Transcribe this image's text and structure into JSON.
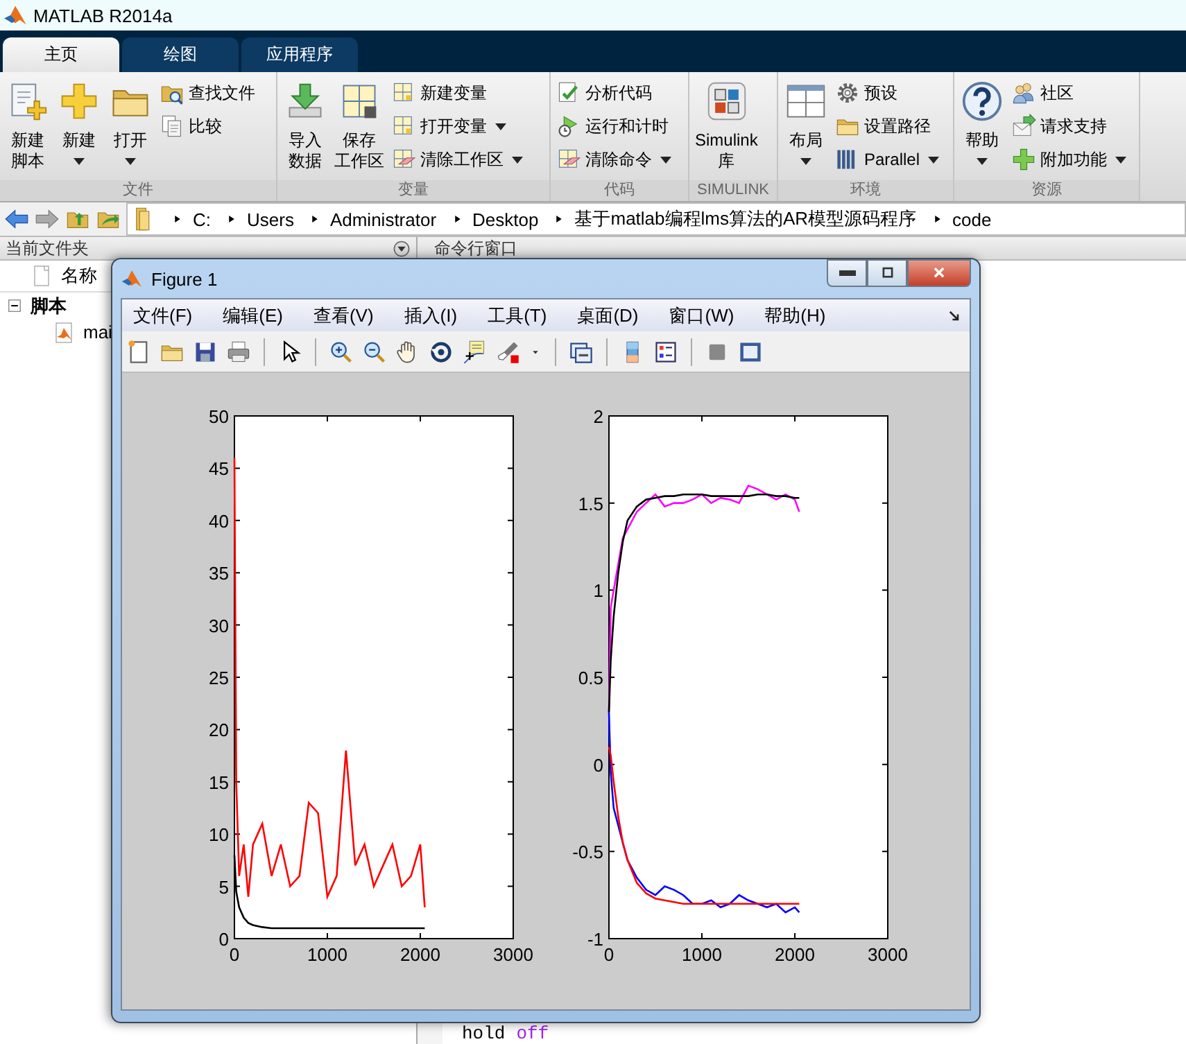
{
  "app": {
    "title": "MATLAB R2014a"
  },
  "tabs": [
    {
      "label": "主页",
      "selected": true
    },
    {
      "label": "绘图",
      "selected": false
    },
    {
      "label": "应用程序",
      "selected": false
    }
  ],
  "ribbon": [
    {
      "label": "文件",
      "items": [
        {
          "kind": "large",
          "lines": [
            "新建",
            "脚本"
          ],
          "dropdown": false
        },
        {
          "kind": "large",
          "lines": [
            "新建"
          ],
          "dropdown": true
        },
        {
          "kind": "large",
          "lines": [
            "打开"
          ],
          "dropdown": true
        },
        {
          "kind": "stack",
          "items": [
            {
              "label": "查找文件",
              "dropdown": false
            },
            {
              "label": "比较",
              "dropdown": false
            }
          ]
        }
      ]
    },
    {
      "label": "变量",
      "items": [
        {
          "kind": "large",
          "lines": [
            "导入",
            "数据"
          ],
          "dropdown": false
        },
        {
          "kind": "large",
          "lines": [
            "保存",
            "工作区"
          ],
          "dropdown": false
        },
        {
          "kind": "stack",
          "items": [
            {
              "label": "新建变量",
              "dropdown": false
            },
            {
              "label": "打开变量",
              "dropdown": true
            },
            {
              "label": "清除工作区",
              "dropdown": true
            }
          ]
        }
      ]
    },
    {
      "label": "代码",
      "items": [
        {
          "kind": "stack",
          "items": [
            {
              "label": "分析代码",
              "dropdown": false
            },
            {
              "label": "运行和计时",
              "dropdown": false
            },
            {
              "label": "清除命令",
              "dropdown": true
            }
          ]
        }
      ]
    },
    {
      "label": "SIMULINK",
      "items": [
        {
          "kind": "large",
          "lines": [
            "Simulink",
            "库"
          ],
          "dropdown": false
        }
      ]
    },
    {
      "label": "环境",
      "items": [
        {
          "kind": "large",
          "lines": [
            "布局"
          ],
          "dropdown": true
        },
        {
          "kind": "stack",
          "items": [
            {
              "label": "预设",
              "dropdown": false
            },
            {
              "label": "设置路径",
              "dropdown": false
            },
            {
              "label": "Parallel",
              "dropdown": true
            }
          ]
        }
      ]
    },
    {
      "label": "资源",
      "items": [
        {
          "kind": "large",
          "lines": [
            "帮助"
          ],
          "dropdown": true
        },
        {
          "kind": "stack",
          "items": [
            {
              "label": "社区",
              "dropdown": false
            },
            {
              "label": "请求支持",
              "dropdown": false
            },
            {
              "label": "附加功能",
              "dropdown": true
            }
          ]
        }
      ]
    }
  ],
  "address_bar": {
    "path": [
      "C:",
      "Users",
      "Administrator",
      "Desktop",
      "基于matlab编程lms算法的AR模型源码程序",
      "code"
    ]
  },
  "current_folder": {
    "title": "当前文件夹",
    "column": "名称",
    "tree": [
      {
        "label": "脚本",
        "expanded": true,
        "children": [
          {
            "label": "mai"
          }
        ]
      }
    ]
  },
  "command_window": {
    "title": "命令行窗口",
    "code": [
      {
        "text": "hold",
        "kind": "plain"
      },
      {
        "text": "off",
        "kind": "keyword"
      }
    ]
  },
  "figure": {
    "title": "Figure 1",
    "menus": [
      "文件(F)",
      "编辑(E)",
      "查看(V)",
      "插入(I)",
      "工具(T)",
      "桌面(D)",
      "窗口(W)",
      "帮助(H)"
    ],
    "plots": [
      {
        "chart_data": {
          "type": "line",
          "x": [
            0,
            20,
            50,
            100,
            150,
            200,
            300,
            400,
            500,
            600,
            700,
            800,
            900,
            1000,
            1100,
            1200,
            1300,
            1400,
            1500,
            1600,
            1700,
            1800,
            1900,
            2000,
            2048
          ],
          "series": [
            {
              "color": "#ff0000",
              "values": [
                46,
                15,
                6,
                9,
                4,
                9,
                11,
                6,
                9,
                5,
                6,
                13,
                12,
                4,
                6,
                18,
                7,
                9,
                5,
                7,
                9,
                5,
                6,
                9,
                3
              ]
            },
            {
              "color": "#000000",
              "values": [
                8,
                4.5,
                3,
                2,
                1.5,
                1.3,
                1.1,
                1,
                1,
                1,
                1,
                1,
                1,
                1,
                1,
                1,
                1,
                1,
                1,
                1,
                1,
                1,
                1,
                1,
                1
              ]
            }
          ],
          "xlim": [
            0,
            3000
          ],
          "ylim": [
            0,
            50
          ],
          "xticks": [
            0,
            1000,
            2000,
            3000
          ],
          "yticks": [
            0,
            5,
            10,
            15,
            20,
            25,
            30,
            35,
            40,
            45,
            50
          ]
        }
      },
      {
        "chart_data": {
          "type": "line",
          "x": [
            0,
            20,
            50,
            100,
            150,
            200,
            300,
            400,
            500,
            600,
            700,
            800,
            900,
            1000,
            1100,
            1200,
            1300,
            1400,
            1500,
            1600,
            1700,
            1800,
            1900,
            2000,
            2048
          ],
          "series": [
            {
              "color": "#ff00ff",
              "values": [
                0.3,
                0.9,
                1.0,
                1.15,
                1.3,
                1.35,
                1.45,
                1.5,
                1.55,
                1.48,
                1.5,
                1.5,
                1.52,
                1.55,
                1.5,
                1.53,
                1.52,
                1.5,
                1.6,
                1.58,
                1.55,
                1.52,
                1.55,
                1.52,
                1.45
              ]
            },
            {
              "color": "#000000",
              "values": [
                0.3,
                0.6,
                0.85,
                1.1,
                1.28,
                1.4,
                1.48,
                1.52,
                1.53,
                1.54,
                1.54,
                1.55,
                1.55,
                1.55,
                1.54,
                1.54,
                1.54,
                1.54,
                1.54,
                1.55,
                1.55,
                1.54,
                1.54,
                1.53,
                1.53
              ]
            },
            {
              "color": "#0000ff",
              "values": [
                0.3,
                -0.05,
                -0.25,
                -0.35,
                -0.45,
                -0.55,
                -0.65,
                -0.72,
                -0.75,
                -0.7,
                -0.72,
                -0.75,
                -0.8,
                -0.8,
                -0.78,
                -0.82,
                -0.8,
                -0.75,
                -0.78,
                -0.8,
                -0.82,
                -0.8,
                -0.85,
                -0.82,
                -0.85
              ]
            },
            {
              "color": "#ff0000",
              "values": [
                0.1,
                0.05,
                -0.1,
                -0.3,
                -0.45,
                -0.55,
                -0.68,
                -0.74,
                -0.77,
                -0.78,
                -0.79,
                -0.8,
                -0.8,
                -0.8,
                -0.8,
                -0.8,
                -0.8,
                -0.8,
                -0.8,
                -0.8,
                -0.8,
                -0.8,
                -0.8,
                -0.8,
                -0.8
              ]
            }
          ],
          "xlim": [
            0,
            3000
          ],
          "ylim": [
            -1,
            2
          ],
          "xticks": [
            0,
            1000,
            2000,
            3000
          ],
          "yticks": [
            -1,
            -0.5,
            0,
            0.5,
            1,
            1.5,
            2
          ]
        }
      }
    ]
  }
}
